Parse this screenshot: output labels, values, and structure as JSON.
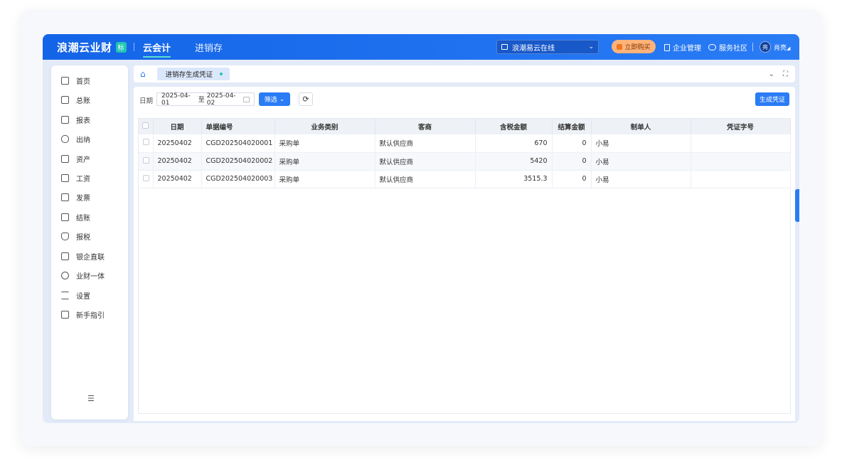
{
  "header": {
    "brand": "浪潮云业财",
    "brand_badge": "标",
    "nav": [
      "云会计",
      "进销存"
    ],
    "org_name": "浪潮易云在线",
    "buy_label": "立即购买",
    "links": [
      "企业管理",
      "服务社区"
    ],
    "avatar_text": "亮",
    "user_name": "肖亮"
  },
  "sidebar": {
    "items": [
      "首页",
      "总账",
      "报表",
      "出纳",
      "资产",
      "工资",
      "发票",
      "结账",
      "报税",
      "银企直联",
      "业财一体",
      "设置",
      "新手指引"
    ]
  },
  "tabs": {
    "active_tab": "进销存生成凭证"
  },
  "toolbar": {
    "date_label": "日期",
    "date_start": "2025-04-01",
    "date_sep": "至",
    "date_end": "2025-04-02",
    "filter_label": "筛选",
    "generate_label": "生成凭证"
  },
  "table": {
    "headers": [
      "日期",
      "单据编号",
      "业务类别",
      "客商",
      "含税金额",
      "结算金额",
      "制单人",
      "凭证字号"
    ],
    "rows": [
      [
        "20250402",
        "CGD202504020001",
        "采购单",
        "默认供应商",
        "670",
        "0",
        "小易",
        ""
      ],
      [
        "20250402",
        "CGD202504020002",
        "采购单",
        "默认供应商",
        "5420",
        "0",
        "小易",
        ""
      ],
      [
        "20250402",
        "CGD202504020003",
        "采购单",
        "默认供应商",
        "3515.3",
        "0",
        "小易",
        ""
      ]
    ]
  },
  "colors": {
    "primary": "#2a7cf5",
    "accent": "#22c6b4"
  }
}
